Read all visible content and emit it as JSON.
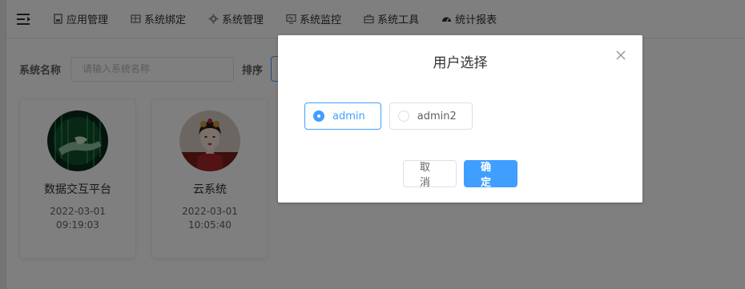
{
  "nav": {
    "items": [
      {
        "label": "应用管理",
        "icon": "document-icon"
      },
      {
        "label": "系统绑定",
        "icon": "table-icon"
      },
      {
        "label": "系统管理",
        "icon": "gear-icon"
      },
      {
        "label": "系统监控",
        "icon": "monitor-icon"
      },
      {
        "label": "系统工具",
        "icon": "toolbox-icon"
      },
      {
        "label": "统计报表",
        "icon": "dashboard-icon"
      }
    ]
  },
  "search": {
    "name_label": "系统名称",
    "name_placeholder": "请输入系统名称",
    "sort_label": "排序"
  },
  "cards": [
    {
      "title": "数据交互平台",
      "date": "2022-03-01",
      "time": "09:19:03"
    },
    {
      "title": "云系统",
      "date": "2022-03-01",
      "time": "10:05:40"
    }
  ],
  "dialog": {
    "title": "用户选择",
    "options": [
      {
        "label": "admin",
        "checked": true
      },
      {
        "label": "admin2",
        "checked": false
      }
    ],
    "cancel_label": "取消",
    "confirm_label": "确定"
  },
  "colors": {
    "accent": "#409eff",
    "overlay": "rgba(0,0,0,0.5)"
  }
}
